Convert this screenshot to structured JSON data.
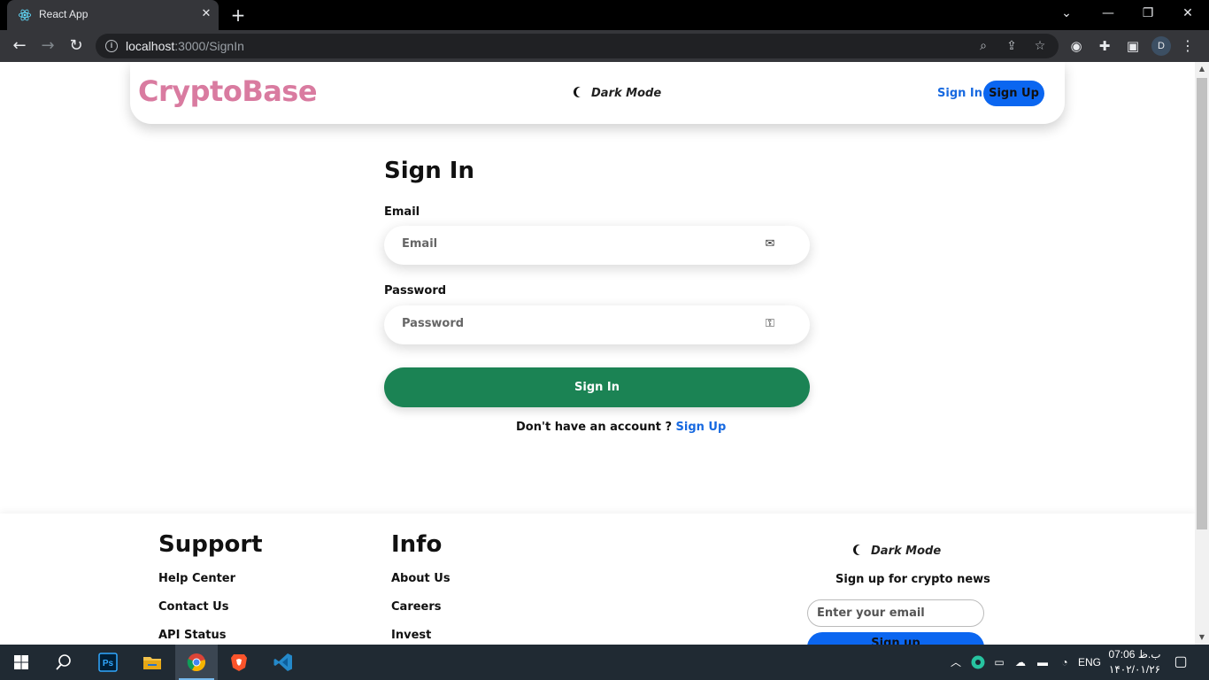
{
  "browser": {
    "tab_title": "React App",
    "tab_close": "✕",
    "new_tab": "+",
    "url_host": "localhost",
    "url_path": ":3000/SignIn",
    "profile_initial": "D"
  },
  "nav": {
    "brand": "CryptoBase",
    "dark_mode": "Dark Mode",
    "signin": "Sign In",
    "signup": "Sign Up"
  },
  "form": {
    "title": "Sign In",
    "email_label": "Email",
    "email_placeholder": "Email",
    "password_label": "Password",
    "password_placeholder": "Password",
    "submit": "Sign In",
    "account_prompt": "Don't have an account ? ",
    "account_link": "Sign Up"
  },
  "footer": {
    "support_heading": "Support",
    "support_links": [
      "Help Center",
      "Contact Us",
      "API Status"
    ],
    "info_heading": "Info",
    "info_links": [
      "About Us",
      "Careers",
      "Invest"
    ],
    "dark_mode": "Dark Mode",
    "newsletter_text": "Sign up for crypto news",
    "email_placeholder": "Enter your email",
    "signup_button": "Sign up"
  },
  "taskbar": {
    "lang": "ENG",
    "time": "07:06 ب.ظ",
    "date": "۱۴۰۲/۰۱/۲۶"
  },
  "colors": {
    "brand": "#d97ba0",
    "primary_blue": "#0b66f0",
    "link_blue": "#1769e0",
    "submit_green": "#1b8354"
  }
}
